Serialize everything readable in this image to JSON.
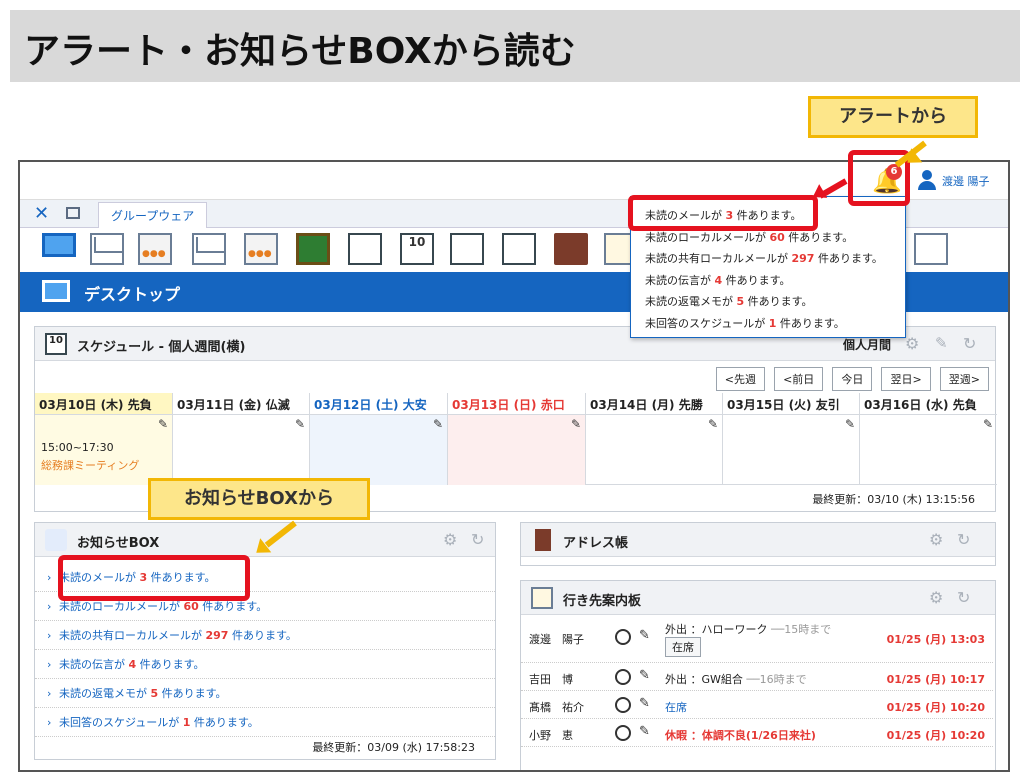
{
  "slide": {
    "title": "アラート・お知らせBOXから読む"
  },
  "header": {
    "alert_count": "6",
    "user_name": "渡邊 陽子"
  },
  "tabs": {
    "active": "グループウェア"
  },
  "desktop": {
    "title": "デスクトップ"
  },
  "schedule": {
    "title": "スケジュール - 個人週間(横)",
    "view_label": "個人月間",
    "nav": [
      "<先週",
      "<前日",
      "今日",
      "翌日>",
      "翌週>"
    ],
    "days": [
      {
        "label": "03月10日 (木) 先負"
      },
      {
        "label": "03月11日 (金) 仏滅"
      },
      {
        "label": "03月12日 (土) 大安"
      },
      {
        "label": "03月13日 (日) 赤口"
      },
      {
        "label": "03月14日 (月) 先勝"
      },
      {
        "label": "03月15日 (火) 友引"
      },
      {
        "label": "03月16日 (水) 先負"
      }
    ],
    "event_time": "15:00~17:30",
    "event_name": "総務課ミーティング",
    "updated": "最終更新：03/10 (木) 13:15:56"
  },
  "notice": {
    "title": "お知らせBOX",
    "items": [
      {
        "pre": "未読のメールが ",
        "count": "3",
        "post": " 件あります。"
      },
      {
        "pre": "未読のローカルメールが ",
        "count": "60",
        "post": " 件あります。"
      },
      {
        "pre": "未読の共有ローカルメールが ",
        "count": "297",
        "post": " 件あります。"
      },
      {
        "pre": "未読の伝言が ",
        "count": "4",
        "post": " 件あります。"
      },
      {
        "pre": "未読の返電メモが ",
        "count": "5",
        "post": " 件あります。"
      },
      {
        "pre": "未回答のスケジュールが ",
        "count": "1",
        "post": " 件あります。"
      }
    ],
    "updated": "最終更新：03/09 (水) 17:58:23"
  },
  "address": {
    "title": "アドレス帳"
  },
  "location": {
    "title": "行き先案内板",
    "rows": [
      {
        "name": "渡邊　陽子",
        "status": "外出 ：ハローワーク",
        "until": "──15時まで",
        "button": "在席",
        "time": "01/25 (月) 13:03"
      },
      {
        "name": "吉田　博",
        "status": "外出 ：GW組合",
        "until": "──16時まで",
        "button": "",
        "time": "01/25 (月) 10:17"
      },
      {
        "name": "髙橋　祐介",
        "status": "在席",
        "until": "",
        "button": "",
        "time": "01/25 (月) 10:20"
      },
      {
        "name": "小野　恵",
        "status": "休暇 ：体調不良(1/26日来社)",
        "until": "",
        "button": "",
        "time": "01/25 (月) 10:20"
      }
    ]
  },
  "alert_popup": {
    "items": [
      {
        "pre": "未読のメールが ",
        "count": "3",
        "post": " 件あります。"
      },
      {
        "pre": "未読のローカルメールが ",
        "count": "60",
        "post": " 件あります。"
      },
      {
        "pre": "未読の共有ローカルメールが ",
        "count": "297",
        "post": " 件あります。"
      },
      {
        "pre": "未読の伝言が ",
        "count": "4",
        "post": " 件あります。"
      },
      {
        "pre": "未読の返電メモが ",
        "count": "5",
        "post": " 件あります。"
      },
      {
        "pre": "未回答のスケジュールが ",
        "count": "1",
        "post": " 件あります。"
      }
    ]
  },
  "callouts": {
    "alert": "アラートから",
    "notice": "お知らせBOXから"
  },
  "colors": {
    "accent": "#1565c0",
    "highlight": "#e5121f",
    "callout": "#fde68a"
  }
}
